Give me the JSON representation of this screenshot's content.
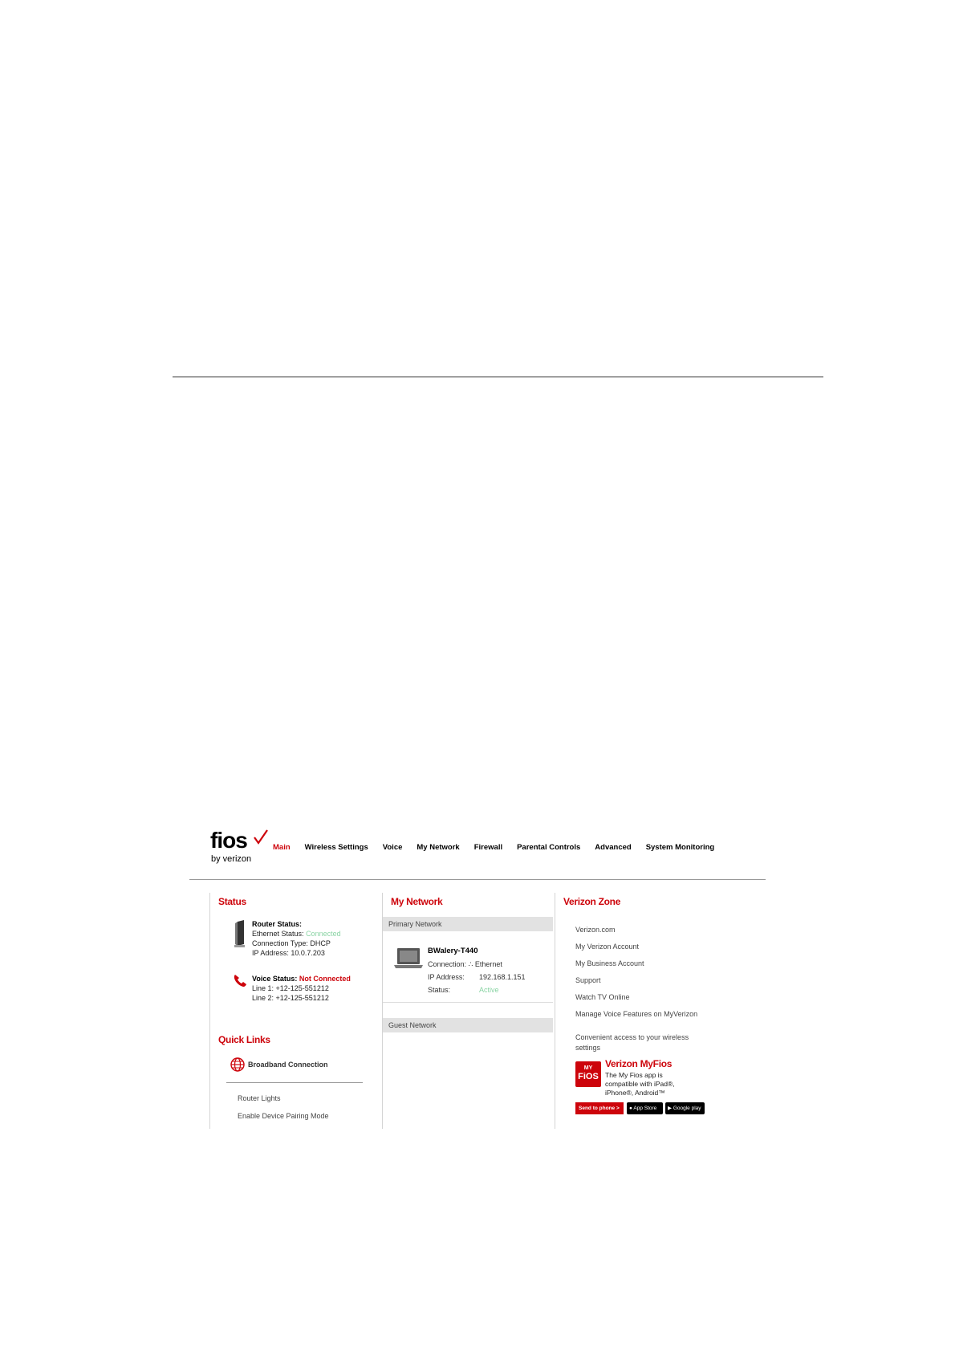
{
  "logo": {
    "word": "fios",
    "sub": "by verizon"
  },
  "nav": {
    "items": [
      {
        "label": "Main",
        "active": true
      },
      {
        "label": "Wireless Settings"
      },
      {
        "label": "Voice"
      },
      {
        "label": "My Network"
      },
      {
        "label": "Firewall"
      },
      {
        "label": "Parental Controls"
      },
      {
        "label": "Advanced"
      },
      {
        "label": "System Monitoring"
      }
    ]
  },
  "status": {
    "title": "Status",
    "router_label": "Router Status:",
    "ethernet_label": "Ethernet Status:",
    "ethernet_value": "Connected",
    "connection_type": "Connection Type: DHCP",
    "ip_address": "IP Address: 10.0.7.203",
    "voice_label": "Voice Status:",
    "voice_value": "Not Connected",
    "line1": "Line 1: +12-125-551212",
    "line2": "Line 2: +12-125-551212"
  },
  "quick_links": {
    "title": "Quick Links",
    "broadband": "Broadband Connection",
    "router_lights": "Router Lights",
    "pairing": "Enable Device Pairing Mode"
  },
  "my_network": {
    "title": "My Network",
    "primary": "Primary Network",
    "guest": "Guest Network",
    "device": {
      "name": "BWalery-T440",
      "connection_label": "Connection:",
      "connection_value": "Ethernet",
      "ip_label": "IP Address:",
      "ip_value": "192.168.1.151",
      "status_label": "Status:",
      "status_value": "Active"
    }
  },
  "verizon_zone": {
    "title": "Verizon Zone",
    "links": [
      "Verizon.com",
      "My Verizon Account",
      "My Business Account",
      "Support",
      "Watch TV Online",
      "Manage Voice Features on MyVerizon"
    ],
    "convenient": "Convenient access to your wireless settings",
    "app_logo_my": "MY",
    "app_logo_fios": "FiOS",
    "app_title": "Verizon MyFios",
    "app_desc": "The My Fios app is compatible with iPad®, iPhone®, Android™",
    "send_button": "Send to phone  >",
    "app_store": "App Store",
    "google_play": "Google play"
  },
  "colors": {
    "brand_red": "#cd040b",
    "status_green": "#8ad4a4",
    "section_gray": "#e2e2e2"
  }
}
